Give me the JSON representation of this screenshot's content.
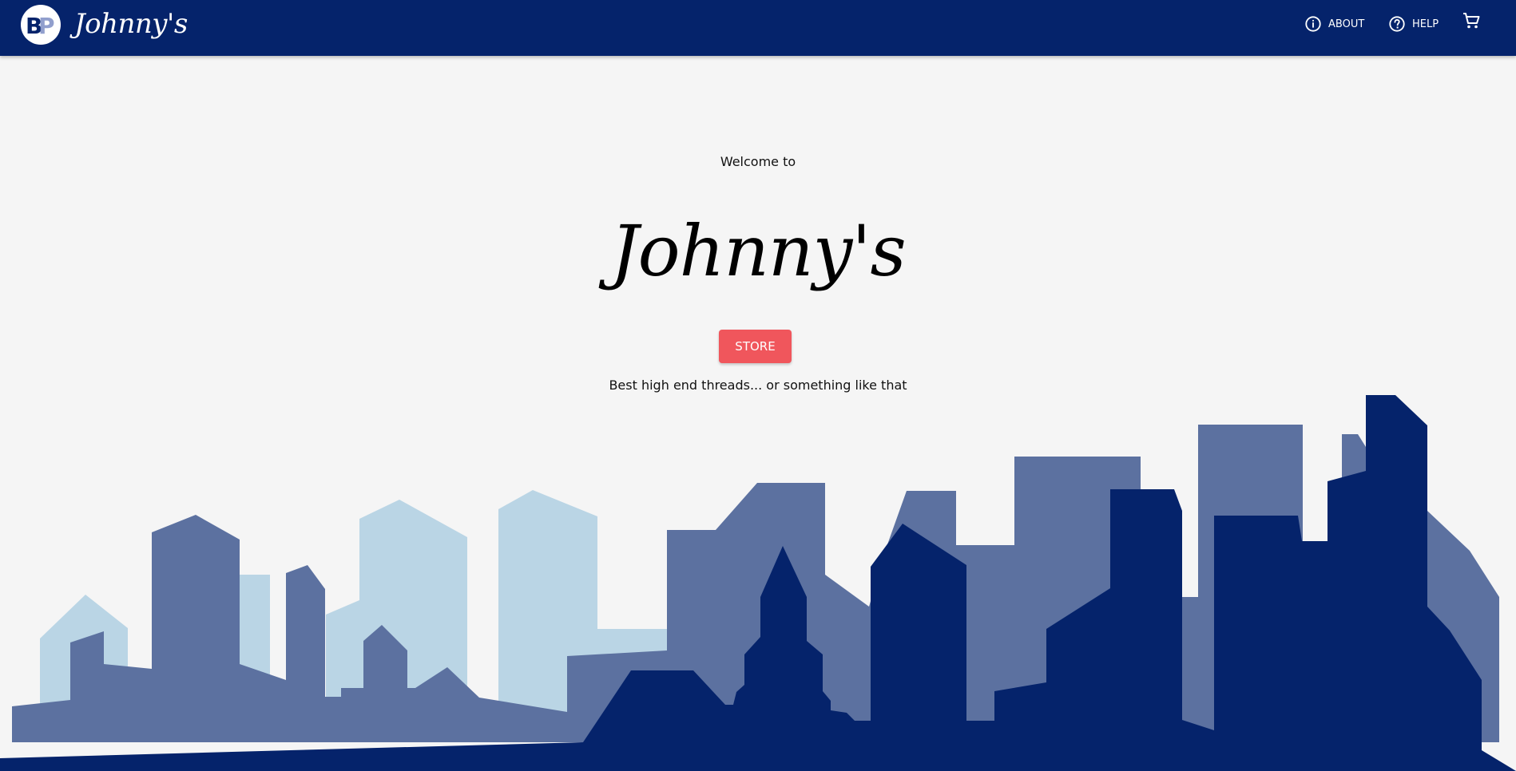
{
  "header": {
    "logo_text": "BP",
    "brand": "Johnny's",
    "nav": {
      "about_label": "ABOUT",
      "help_label": "HELP",
      "about_icon": "info-icon",
      "help_icon": "help-icon",
      "cart_icon": "cart-icon"
    }
  },
  "hero": {
    "welcome": "Welcome to",
    "title": "Johnny's",
    "button_label": "STORE",
    "tagline": "Best high end threads... or something like that"
  },
  "colors": {
    "appbar": "#05236b",
    "background": "#f5f5f5",
    "button": "#f0565c",
    "skyline_light": "#bad5e5",
    "skyline_mid": "#5c71a0",
    "skyline_dark": "#05236b"
  }
}
